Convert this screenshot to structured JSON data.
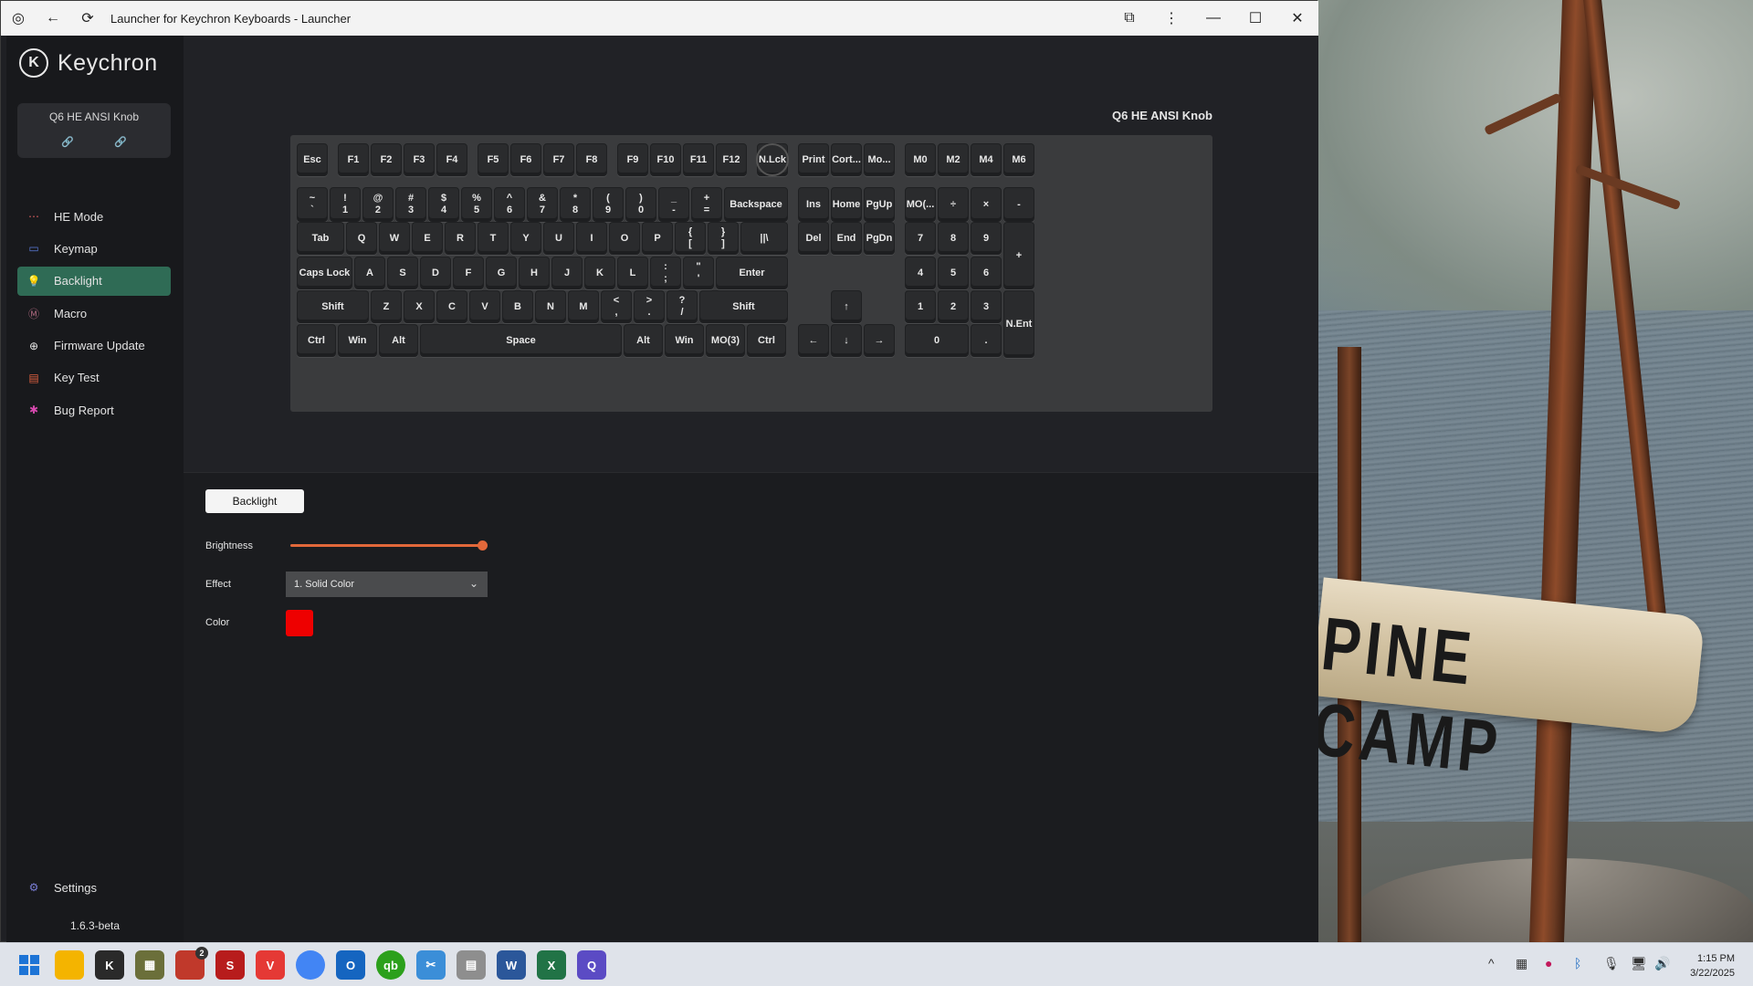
{
  "window": {
    "title": "Launcher for Keychron Keyboards - Launcher"
  },
  "sidebar": {
    "brand": "Keychron",
    "keyboard_name": "Q6 HE ANSI Knob",
    "nav": [
      {
        "label": "HE Mode",
        "icon": "he-mode-icon"
      },
      {
        "label": "Keymap",
        "icon": "keymap-icon"
      },
      {
        "label": "Backlight",
        "icon": "bulb-icon",
        "active": true
      },
      {
        "label": "Macro",
        "icon": "macro-icon"
      },
      {
        "label": "Firmware Update",
        "icon": "firmware-icon"
      },
      {
        "label": "Key Test",
        "icon": "keytest-icon"
      },
      {
        "label": "Bug Report",
        "icon": "bug-icon"
      }
    ],
    "settings_label": "Settings",
    "version": "1.6.3-beta"
  },
  "keyboard": {
    "title": "Q6 HE ANSI Knob",
    "rows": [
      [
        "Esc",
        "F1",
        "F2",
        "F3",
        "F4",
        "F5",
        "F6",
        "F7",
        "F8",
        "F9",
        "F10",
        "F11",
        "F12",
        "N.Lck",
        "Print",
        "Cort...",
        "Mo...",
        "M0",
        "M2",
        "M4",
        "M6"
      ],
      [
        "~|`",
        "!|1",
        "@|2",
        "#|3",
        "$|4",
        "%|5",
        "^|6",
        "&|7",
        "*|8",
        "(|9",
        ")|0",
        "_|-",
        "+|=",
        "Backspace",
        "Ins",
        "Home",
        "PgUp",
        "MO(...",
        "÷",
        "×",
        "-"
      ],
      [
        "Tab",
        "Q",
        "W",
        "E",
        "R",
        "T",
        "Y",
        "U",
        "I",
        "O",
        "P",
        "{|[",
        "}|]",
        "||\\",
        "Del",
        "End",
        "PgDn",
        "7",
        "8",
        "9",
        "+"
      ],
      [
        "Caps Lock",
        "A",
        "S",
        "D",
        "F",
        "G",
        "H",
        "J",
        "K",
        "L",
        ":|;",
        "\"|'",
        "Enter",
        "4",
        "5",
        "6"
      ],
      [
        "Shift",
        "Z",
        "X",
        "C",
        "V",
        "B",
        "N",
        "M",
        "<|,",
        ">|.",
        "?|/",
        "Shift",
        "↑",
        "1",
        "2",
        "3",
        "N.Ent"
      ],
      [
        "Ctrl",
        "Win",
        "Alt",
        "Space",
        "Alt",
        "Win",
        "MO(3)",
        "Ctrl",
        "←",
        "↓",
        "→",
        "0",
        "."
      ]
    ]
  },
  "backlight": {
    "tab_label": "Backlight",
    "brightness_label": "Brightness",
    "brightness_value": 1.0,
    "effect_label": "Effect",
    "effect_value": "1. Solid Color",
    "color_label": "Color",
    "color_value": "#ee0000",
    "accent_color": "#e2683a"
  },
  "taskbar": {
    "time": "1:15 PM",
    "date": "3/22/2025",
    "badge_count": "2"
  },
  "desktop": {
    "sign_text": "PINE CAMP"
  }
}
